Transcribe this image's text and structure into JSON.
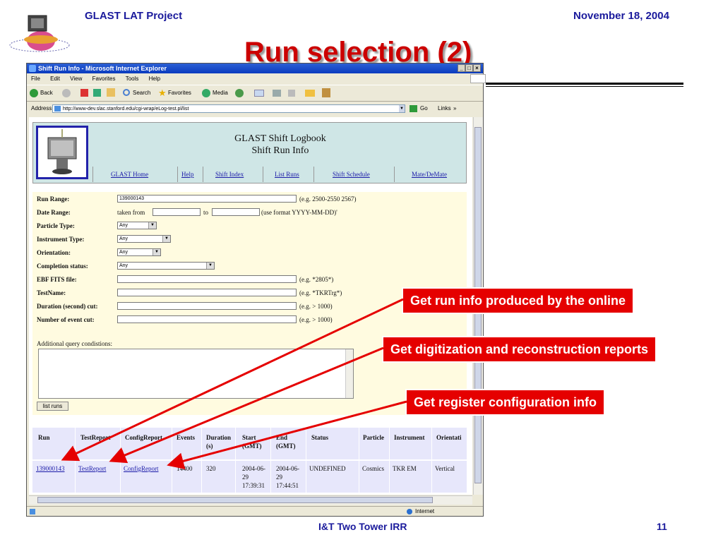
{
  "slide": {
    "header_left": "GLAST LAT Project",
    "header_right": "November 18, 2004",
    "title": "Run selection (2)",
    "footer_center": "I&T Two Tower IRR",
    "footer_page": "11"
  },
  "browser": {
    "window_title": "Shift Run Info - Microsoft Internet Explorer",
    "menu": [
      "File",
      "Edit",
      "View",
      "Favorites",
      "Tools",
      "Help"
    ],
    "toolbar": {
      "back": "Back",
      "search": "Search",
      "favorites": "Favorites",
      "media": "Media"
    },
    "address_label": "Address",
    "address_url": "http://www-dev.slac.stanford.edu/cgi-wrap/eLog-test.pl/list",
    "go_label": "Go",
    "links_label": "Links",
    "status_zone": "Internet"
  },
  "page": {
    "banner_title_line1": "GLAST Shift Logbook",
    "banner_title_line2": "Shift Run Info",
    "nav": [
      "GLAST Home",
      "Help",
      "Shift Index",
      "List Runs",
      "Shift Schedule",
      "Mate/DeMate"
    ],
    "form": {
      "run_range_label": "Run Range:",
      "run_range_value": "139000143",
      "run_range_hint": "(e.g. 2500-2550 2567)",
      "date_range_label": "Date Range:",
      "date_taken_from": "taken from",
      "date_to": "to",
      "date_hint": "(use format YYYY-MM-DD)'",
      "particle_label": "Particle Type:",
      "particle_value": "Any",
      "instrument_label": "Instrument Type:",
      "instrument_value": "Any",
      "orientation_label": "Orientation:",
      "orientation_value": "Any",
      "completion_label": "Completion status:",
      "completion_value": "Any",
      "ebf_label": "EBF FITS file:",
      "ebf_hint": "(e.g. *2805*)",
      "testname_label": "TestName:",
      "testname_hint": "(e.g. *TKRTrg*)",
      "duration_label": "Duration (second) cut:",
      "duration_hint": "(e.g. > 1000)",
      "events_label": "Number of event cut:",
      "events_hint": "(e.g. > 1000)",
      "additional_label": "Additional query condistions:",
      "list_runs_button": "list runs"
    },
    "table": {
      "headers": [
        "Run",
        "TestReport",
        "ConfigReport",
        "Events",
        "Duration (s)",
        "Start (GMT)",
        "End (GMT)",
        "Status",
        "Particle",
        "Instrument",
        "Orientati"
      ],
      "row": [
        "139000143",
        "TestReport",
        "ConfigReport",
        "14400",
        "320",
        "2004-06-29 17:39:31",
        "2004-06-29 17:44:51",
        "UNDEFINED",
        "Cosmics",
        "TKR EM",
        "Vertical"
      ]
    }
  },
  "callouts": [
    "Get run info produced by the online",
    "Get digitization and reconstruction reports",
    "Get register configuration info"
  ],
  "colors": {
    "title_red": "#cc0000",
    "header_blue": "#1a1a9c",
    "callout_red": "#e50000",
    "banner_bg": "#cfe6e6",
    "form_bg": "#fffbe0",
    "table_bg": "#e7e7fb"
  }
}
